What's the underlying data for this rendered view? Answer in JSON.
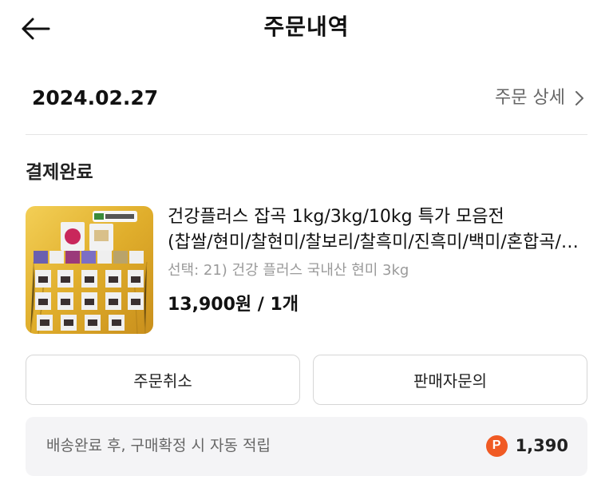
{
  "header": {
    "title": "주문내역",
    "back_icon": "arrow-left-icon"
  },
  "order": {
    "date": "2024.02.27",
    "detail_link": "주문 상세",
    "status": "결제완료"
  },
  "product": {
    "name_line1": "건강플러스 잡곡 1kg/3kg/10kg 특가 모음전",
    "name_line2": "(찹쌀/현미/찰현미/찰보리/찰흑미/진흑미/백미/혼합곡/기타)",
    "option": "선택: 21) 건강 플러스 국내산 현미 3kg",
    "price": "13,900원 / 1개"
  },
  "actions": {
    "cancel_label": "주문취소",
    "inquiry_label": "판매자문의"
  },
  "points": {
    "text": "배송완료 후, 구매확정 시 자동 적립",
    "badge": "P",
    "value": "1,390"
  },
  "colors": {
    "point_badge": "#f05a24",
    "points_bg": "#f4f4f6",
    "thumb_bg": "#e6b63a"
  }
}
